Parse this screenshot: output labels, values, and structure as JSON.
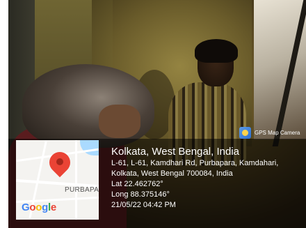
{
  "camera_badge": {
    "label": "GPS Map Camera",
    "icon": "gps-map-camera-app-icon"
  },
  "location": {
    "title": "Kolkata, West Bengal, India",
    "address_line1": "L-61, L-61, Kamdhari Rd, Purbapara, Kamdahari,",
    "address_line2": "Kolkata, West Bengal 700084, India",
    "latitude": "Lat 22.462762°",
    "longitude": "Long 88.375146°",
    "timestamp": "21/05/22 04:42 PM"
  },
  "map": {
    "place_label": "PURBAPAR",
    "logo_letters": [
      "G",
      "o",
      "o",
      "g",
      "l",
      "e"
    ],
    "logo_colors": [
      "#4285F4",
      "#EA4335",
      "#FBBC05",
      "#4285F4",
      "#34A853",
      "#EA4335"
    ],
    "pin_color": "#EA4335"
  }
}
